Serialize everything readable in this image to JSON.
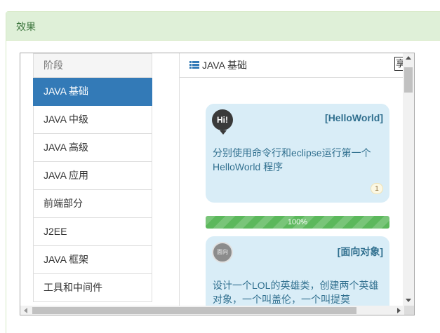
{
  "panel": {
    "title": "效果"
  },
  "sidebar": {
    "header": "阶段",
    "items": [
      {
        "label": "JAVA 基础",
        "active": true
      },
      {
        "label": "JAVA 中级"
      },
      {
        "label": "JAVA 高级"
      },
      {
        "label": "JAVA 应用"
      },
      {
        "label": "前端部分"
      },
      {
        "label": "J2EE"
      },
      {
        "label": "JAVA 框架"
      },
      {
        "label": "工具和中间件"
      }
    ]
  },
  "content": {
    "title": "JAVA 基础",
    "tab_corner": "享",
    "cards": [
      {
        "avatar": "Hi!",
        "title": "[HelloWorld]",
        "text": "分别使用命令行和eclipse运行第一个HelloWorld 程序",
        "badge": "1"
      },
      {
        "avatar": "面向",
        "title": "[面向对象]",
        "text": "设计一个LOL的英雄类，创建两个英雄对象，一个叫盖伦，一个叫提莫"
      }
    ],
    "progress": {
      "label": "100%",
      "value": 100
    }
  },
  "colors": {
    "primary": "#337ab7",
    "success": "#5cb85c",
    "info_bg": "#d9edf7",
    "info_text": "#31708f",
    "panel_bg": "#dff0d8",
    "panel_text": "#3c763d"
  }
}
